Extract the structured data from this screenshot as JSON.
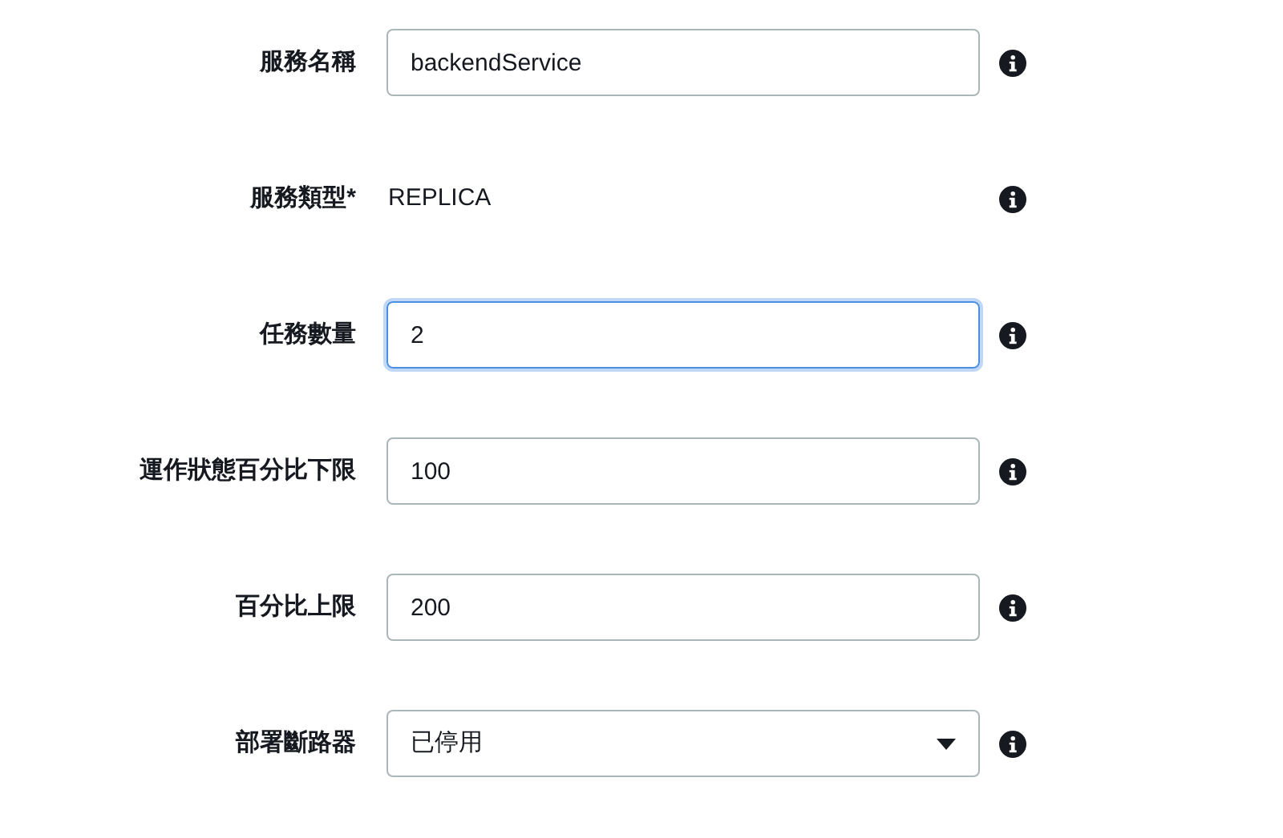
{
  "fields": [
    {
      "kind": "text",
      "label": "服務名稱",
      "value": "backendService",
      "focused": false
    },
    {
      "kind": "static",
      "label": "服務類型*",
      "value": "REPLICA"
    },
    {
      "kind": "text",
      "label": "任務數量",
      "value": "2",
      "focused": true
    },
    {
      "kind": "text",
      "label": "運作狀態百分比下限",
      "value": "100",
      "focused": false
    },
    {
      "kind": "text",
      "label": "百分比上限",
      "value": "200",
      "focused": false
    },
    {
      "kind": "select",
      "label": "部署斷路器",
      "value": "已停用",
      "focused": false
    }
  ]
}
